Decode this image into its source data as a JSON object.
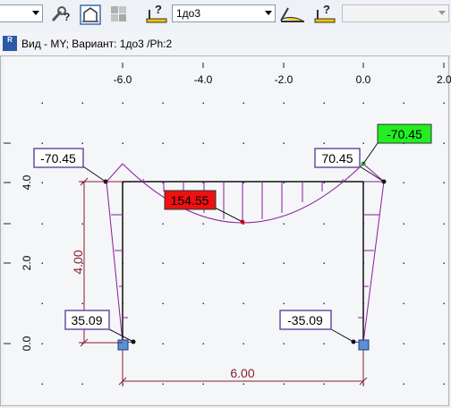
{
  "toolbar": {
    "combo_left_value": "",
    "variant_combo_value": "1до3",
    "right_combo_value": "",
    "buttons": [
      {
        "name": "diagram-help-button",
        "icon": "wrench-question-icon"
      },
      {
        "name": "frame-view-button",
        "icon": "frame-icon"
      },
      {
        "name": "disabled-tool-button",
        "icon": "grey-blocks-icon"
      },
      {
        "name": "scale-question-button",
        "icon": "scale-question-icon"
      },
      {
        "name": "diagram-mode-button",
        "icon": "diagram-icon"
      },
      {
        "name": "scale-question-button-2",
        "icon": "scale-question-icon"
      }
    ]
  },
  "window": {
    "title": "Вид - MY; Вариант: 1до3   /Ph:2",
    "icon_label": "R"
  },
  "axes": {
    "x_ticks": [
      "-6.0",
      "-4.0",
      "-2.0",
      "0.0",
      "2.0"
    ],
    "y_ticks": [
      "4.0",
      "2.0",
      "0.0"
    ]
  },
  "dimensions": {
    "height": "4.00",
    "width": "6.00"
  },
  "labels": {
    "top_left": "-70.45",
    "top_right": "70.45",
    "top_right_green": "-70.45",
    "midspan_red": "154.55",
    "bottom_left": "35.09",
    "bottom_right": "-35.09"
  },
  "colors": {
    "diagram": "#8b1a9b",
    "dimension": "#8b1c2a",
    "label_border": "#6a4fa0",
    "red_label": "#ee1111",
    "green_label": "#22ee22",
    "support": "#5b8fd6",
    "grid_dot": "#1f2ca8"
  }
}
